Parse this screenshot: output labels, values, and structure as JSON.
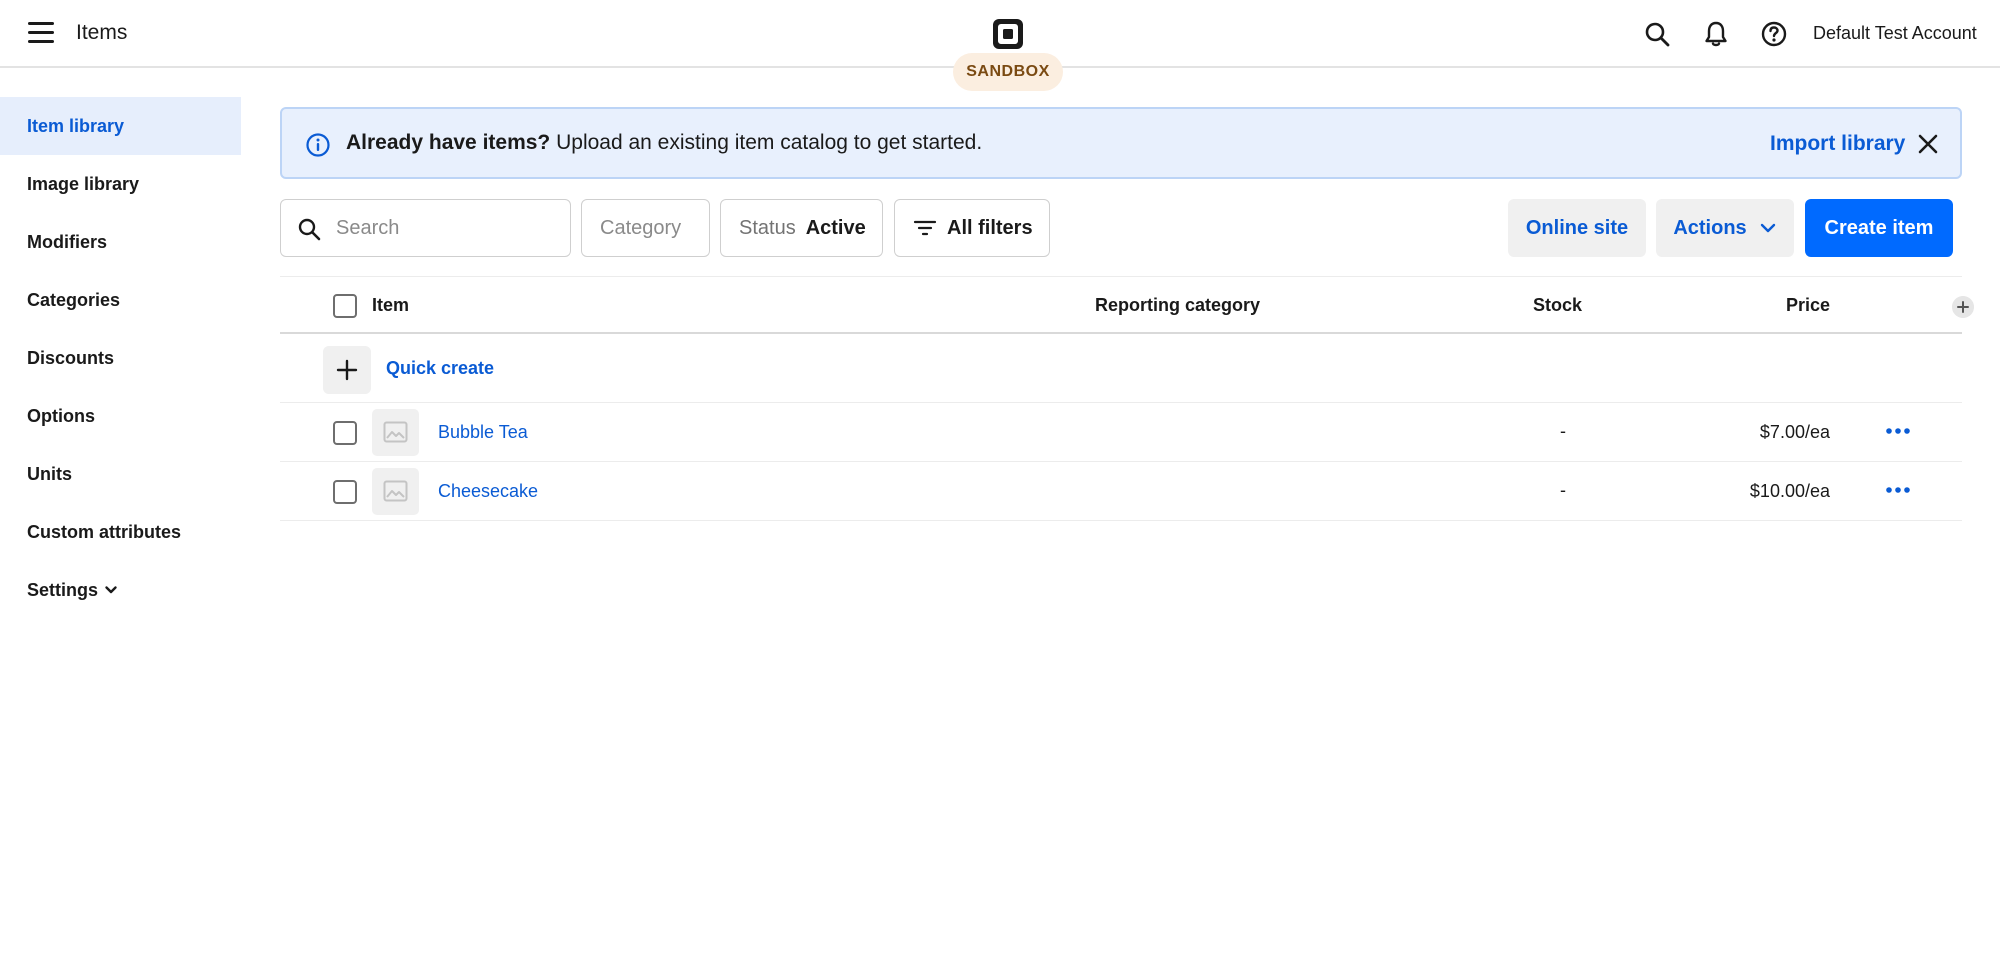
{
  "topbar": {
    "title": "Items",
    "badge": "SANDBOX",
    "account": "Default Test Account"
  },
  "sidebar": {
    "items": [
      {
        "label": "Item library"
      },
      {
        "label": "Image library"
      },
      {
        "label": "Modifiers"
      },
      {
        "label": "Categories"
      },
      {
        "label": "Discounts"
      },
      {
        "label": "Options"
      },
      {
        "label": "Units"
      },
      {
        "label": "Custom attributes"
      },
      {
        "label": "Settings"
      }
    ]
  },
  "banner": {
    "bold": "Already have items?",
    "text": " Upload an existing item catalog to get started.",
    "link": "Import library"
  },
  "filters": {
    "search_placeholder": "Search",
    "category": "Category",
    "status_label": "Status",
    "status_value": "Active",
    "all_filters": "All filters"
  },
  "actions": {
    "online_site": "Online site",
    "actions": "Actions",
    "create_item": "Create item"
  },
  "table": {
    "columns": {
      "item": "Item",
      "reporting_category": "Reporting category",
      "stock": "Stock",
      "price": "Price"
    },
    "quick_create": "Quick create",
    "rows": [
      {
        "name": "Bubble Tea",
        "stock": "-",
        "price": "$7.00/ea"
      },
      {
        "name": "Cheesecake",
        "stock": "-",
        "price": "$10.00/ea"
      }
    ]
  },
  "colors": {
    "accent": "#006aff",
    "link": "#0a5bd4",
    "banner_bg": "#e8f0fd",
    "badge_bg": "#fbeee0"
  },
  "icons": [
    "menu-icon",
    "square-logo-icon",
    "search-icon",
    "bell-icon",
    "help-icon",
    "info-icon",
    "close-icon",
    "filter-icon",
    "chevron-down-icon",
    "plus-icon",
    "image-placeholder-icon",
    "more-icon"
  ]
}
